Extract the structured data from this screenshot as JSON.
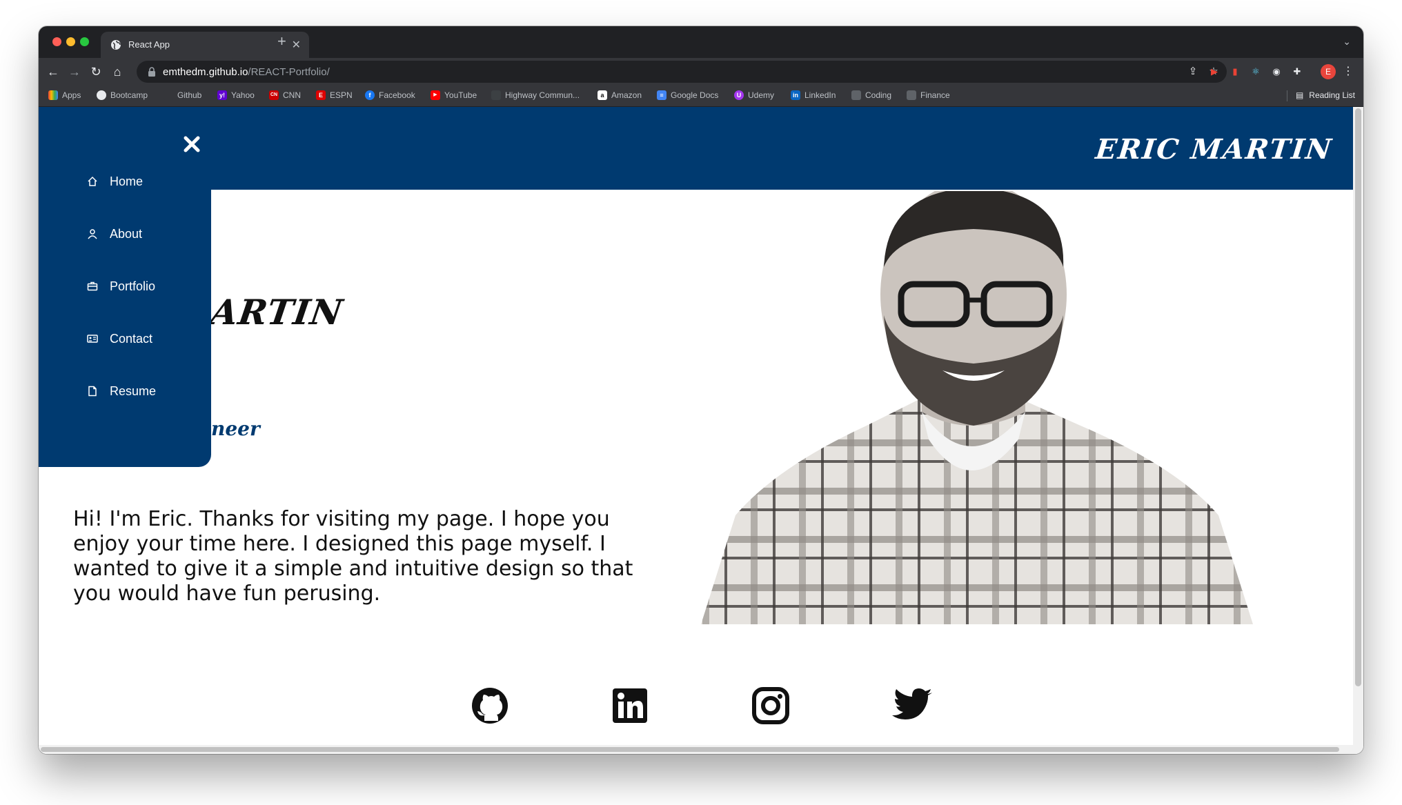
{
  "browser": {
    "tab_title": "React App",
    "url_host": "emthedm.github.io",
    "url_path": "/REACT-Portfolio/",
    "profile_initial": "E",
    "bookmarks": [
      {
        "label": "Apps",
        "icon": "apps-grid-icon",
        "color": "#ea4335"
      },
      {
        "label": "Bootcamp",
        "icon": "globe-icon",
        "color": "#9aa0a6"
      },
      {
        "label": "Github",
        "icon": "github-icon",
        "color": "#202124"
      },
      {
        "label": "Yahoo",
        "icon": "yahoo-icon",
        "color": "#6001d2"
      },
      {
        "label": "CNN",
        "icon": "cnn-icon",
        "color": "#cc0000"
      },
      {
        "label": "ESPN",
        "icon": "espn-icon",
        "color": "#d00"
      },
      {
        "label": "Facebook",
        "icon": "facebook-icon",
        "color": "#1877f2"
      },
      {
        "label": "YouTube",
        "icon": "youtube-icon",
        "color": "#ff0000"
      },
      {
        "label": "Highway Commun...",
        "icon": "highway-icon",
        "color": "#202124"
      },
      {
        "label": "Amazon",
        "icon": "amazon-icon",
        "color": "#ffffff"
      },
      {
        "label": "Google Docs",
        "icon": "docs-icon",
        "color": "#4285f4"
      },
      {
        "label": "Udemy",
        "icon": "udemy-icon",
        "color": "#a435f0"
      },
      {
        "label": "LinkedIn",
        "icon": "linkedin-icon",
        "color": "#0a66c2"
      },
      {
        "label": "Coding",
        "icon": "folder-icon",
        "color": "#5f6368"
      },
      {
        "label": "Finance",
        "icon": "folder-icon",
        "color": "#5f6368"
      }
    ],
    "reading_list": "Reading List"
  },
  "site": {
    "brand": "Eric Martin",
    "hero_name_fragment": "ARTIN",
    "hero_role_fragment": "neer",
    "intro": "Hi! I'm Eric. Thanks for visiting my page. I hope you enjoy your time here. I designed this page myself. I wanted to give it a simple and intuitive design so that you would have fun perusing.",
    "accent_color": "#003a70",
    "nav": [
      {
        "label": "Home",
        "icon": "home-icon"
      },
      {
        "label": "About",
        "icon": "person-icon"
      },
      {
        "label": "Portfolio",
        "icon": "briefcase-icon"
      },
      {
        "label": "Contact",
        "icon": "contact-card-icon"
      },
      {
        "label": "Resume",
        "icon": "document-icon"
      }
    ],
    "social": [
      {
        "icon": "github-icon"
      },
      {
        "icon": "linkedin-icon"
      },
      {
        "icon": "instagram-icon"
      },
      {
        "icon": "twitter-icon"
      }
    ]
  }
}
